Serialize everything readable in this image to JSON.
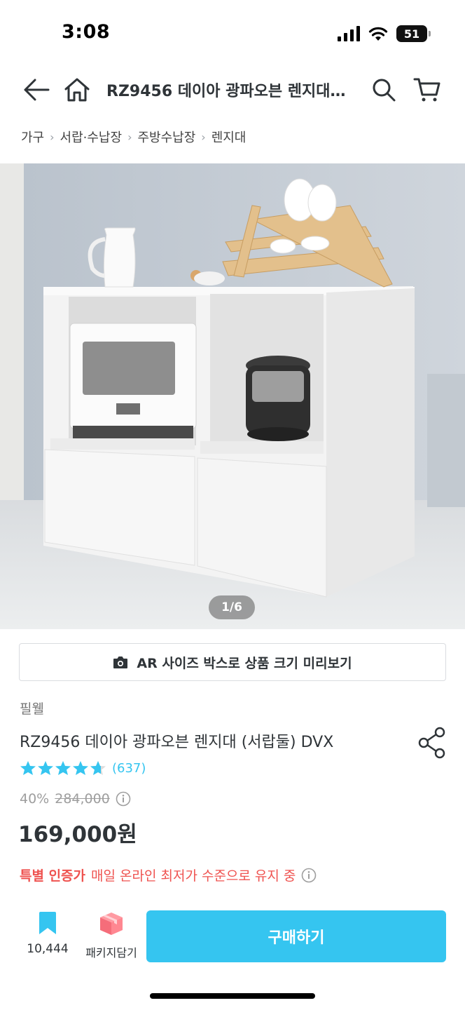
{
  "status": {
    "time": "3:08",
    "battery": "51"
  },
  "nav": {
    "title": "RZ9456 데이아 광파오븐 렌지대 (서랍둘) DVX"
  },
  "breadcrumb": [
    "가구",
    "서랍·수납장",
    "주방수납장",
    "렌지대"
  ],
  "hero": {
    "counter": "1/6"
  },
  "ar": {
    "label": "AR 사이즈 박스로 상품 크기 미리보기"
  },
  "product": {
    "brand": "필웰",
    "name": "RZ9456 데이아 광파오븐 렌지대 (서랍둘) DVX",
    "rating": 4.7,
    "review_count": "(637)",
    "discount_rate": "40%",
    "original_price": "284,000",
    "sale_price": "169,000원"
  },
  "special": {
    "badge": "특별 인증가",
    "text": "매일 온라인 최저가 수준으로 유지 중"
  },
  "bottom": {
    "bookmark_count": "10,444",
    "package_label": "패키지담기",
    "buy_label": "구매하기"
  },
  "colors": {
    "accent": "#35c5f0",
    "special": "#ef5350",
    "text": "#2f3438",
    "muted": "#9e9e9e"
  },
  "icons": [
    "back-arrow-icon",
    "home-icon",
    "search-icon",
    "cart-icon",
    "camera-icon",
    "share-icon",
    "star-icon",
    "info-icon",
    "bookmark-icon",
    "package-box-icon"
  ]
}
